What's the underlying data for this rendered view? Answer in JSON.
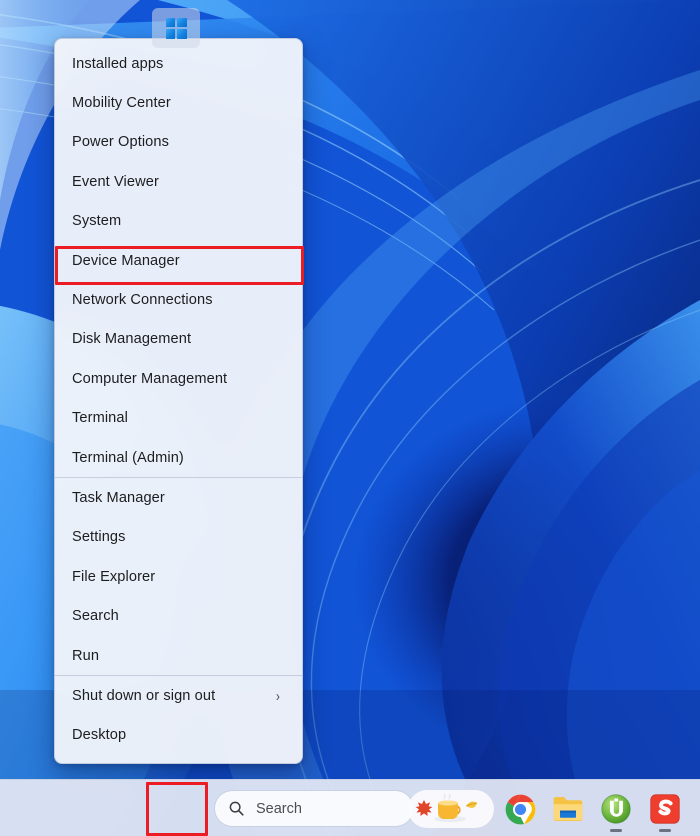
{
  "desktop": {
    "wallpaper_name": "windows-11-bloom-wallpaper",
    "accent_color": "#0a6dcc",
    "background_colors": [
      "#4aa8f8",
      "#1f7ced",
      "#1150d8",
      "#0c2fa6",
      "#081c74",
      "#050e3c"
    ]
  },
  "annotations": {
    "highlight_color": "#ec1c24",
    "device_manager_box_name": "device-manager-highlight",
    "start_button_box_name": "start-button-highlight"
  },
  "winx_menu": {
    "name": "win-x-power-user-menu",
    "background_color": "#f0f4fa",
    "items": [
      {
        "label": "Installed apps",
        "has_submenu": false,
        "separator_after": false,
        "highlighted": false
      },
      {
        "label": "Mobility Center",
        "has_submenu": false,
        "separator_after": false,
        "highlighted": false
      },
      {
        "label": "Power Options",
        "has_submenu": false,
        "separator_after": false,
        "highlighted": false
      },
      {
        "label": "Event Viewer",
        "has_submenu": false,
        "separator_after": false,
        "highlighted": false
      },
      {
        "label": "System",
        "has_submenu": false,
        "separator_after": false,
        "highlighted": false
      },
      {
        "label": "Device Manager",
        "has_submenu": false,
        "separator_after": false,
        "highlighted": true
      },
      {
        "label": "Network Connections",
        "has_submenu": false,
        "separator_after": false,
        "highlighted": false
      },
      {
        "label": "Disk Management",
        "has_submenu": false,
        "separator_after": false,
        "highlighted": false
      },
      {
        "label": "Computer Management",
        "has_submenu": false,
        "separator_after": false,
        "highlighted": false
      },
      {
        "label": "Terminal",
        "has_submenu": false,
        "separator_after": false,
        "highlighted": false
      },
      {
        "label": "Terminal (Admin)",
        "has_submenu": false,
        "separator_after": true,
        "highlighted": false
      },
      {
        "label": "Task Manager",
        "has_submenu": false,
        "separator_after": false,
        "highlighted": false
      },
      {
        "label": "Settings",
        "has_submenu": false,
        "separator_after": false,
        "highlighted": false
      },
      {
        "label": "File Explorer",
        "has_submenu": false,
        "separator_after": false,
        "highlighted": false
      },
      {
        "label": "Search",
        "has_submenu": false,
        "separator_after": false,
        "highlighted": false
      },
      {
        "label": "Run",
        "has_submenu": false,
        "separator_after": true,
        "highlighted": false
      },
      {
        "label": "Shut down or sign out",
        "has_submenu": true,
        "separator_after": false,
        "highlighted": false
      },
      {
        "label": "Desktop",
        "has_submenu": false,
        "separator_after": false,
        "highlighted": false
      }
    ],
    "submenu_glyph": "›"
  },
  "taskbar": {
    "background_color": "#e2e7f3",
    "start_button": {
      "label": "Start",
      "icon": "windows-logo-icon"
    },
    "search": {
      "placeholder": "Search",
      "value": "",
      "icon": "search-icon"
    },
    "icons": [
      {
        "name": "widgets-weather-icon",
        "label": "Widgets",
        "running": false
      },
      {
        "name": "chrome-icon",
        "label": "Google Chrome",
        "running": false
      },
      {
        "name": "file-explorer-icon",
        "label": "File Explorer",
        "running": false
      },
      {
        "name": "utorrent-icon",
        "label": "uTorrent",
        "running": true
      },
      {
        "name": "snagit-icon",
        "label": "Snagit",
        "running": true
      }
    ]
  }
}
